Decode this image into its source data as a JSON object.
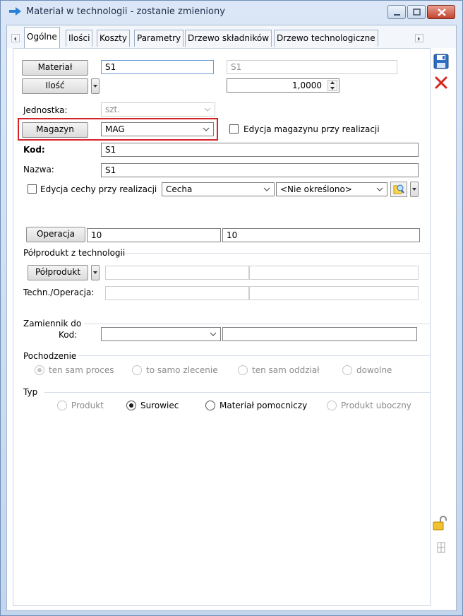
{
  "window": {
    "title": "Materiał w technologii - zostanie zmieniony"
  },
  "tabs": [
    {
      "label": "Ogólne",
      "active": true
    },
    {
      "label": "Ilości"
    },
    {
      "label": "Koszty"
    },
    {
      "label": "Parametry"
    },
    {
      "label": "Drzewo składników"
    },
    {
      "label": "Drzewo technologiczne"
    }
  ],
  "material": {
    "button": "Materiał",
    "code_value": "S1",
    "readonly_value": "S1"
  },
  "quantity": {
    "button": "Ilość",
    "value": "1,0000"
  },
  "unit": {
    "label": "Jednostka:",
    "value": "szt."
  },
  "warehouse": {
    "button": "Magazyn",
    "value": "MAG",
    "edit_checkbox_label": "Edycja magazynu przy realizacji",
    "highlight_color": "#d5232a"
  },
  "code": {
    "label": "Kod:",
    "value": "S1"
  },
  "name": {
    "label": "Nazwa:",
    "value": "S1"
  },
  "feature": {
    "checkbox_label": "Edycja cechy przy realizacji",
    "select_value": "Cecha",
    "value_select": "<Nie określono>"
  },
  "operation": {
    "button": "Operacja",
    "value1": "10",
    "value2": "10"
  },
  "semi_product": {
    "group_title": "Półprodukt z technologii",
    "button": "Półprodukt",
    "tech_label": "Techn./Operacja:"
  },
  "substitute": {
    "group_title": "Zamiennik do",
    "code_label": "Kod:"
  },
  "origin": {
    "group_title": "Pochodzenie",
    "options": [
      "ten sam proces",
      "to samo zlecenie",
      "ten sam oddział",
      "dowolne"
    ],
    "selected": "ten sam proces"
  },
  "type": {
    "group_title": "Typ",
    "options": [
      "Produkt",
      "Surowiec",
      "Materiał pomocniczy",
      "Produkt uboczny"
    ],
    "selected": "Surowiec"
  },
  "side_toolbar": {
    "icons": [
      "save-icon",
      "cancel-icon",
      "unlock-icon",
      "pin-icon"
    ]
  }
}
